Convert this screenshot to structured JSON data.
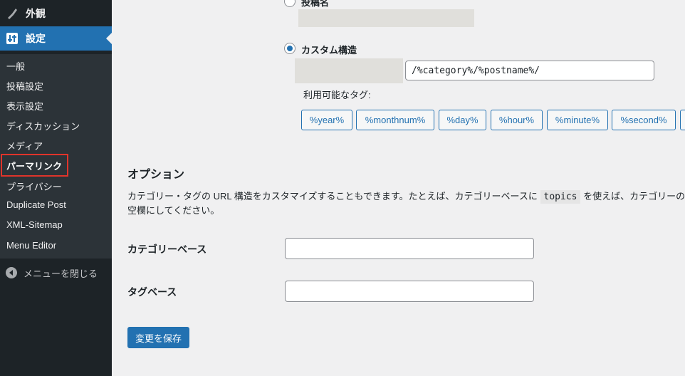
{
  "sidebar": {
    "appearance_label": "外観",
    "settings_label": "設定",
    "submenu": [
      "一般",
      "投稿設定",
      "表示設定",
      "ディスカッション",
      "メディア",
      "パーマリンク",
      "プライバシー",
      "Duplicate Post",
      "XML-Sitemap",
      "Menu Editor"
    ],
    "collapse_label": "メニューを閉じる"
  },
  "permalink": {
    "post_name_label": "投稿名",
    "custom_label": "カスタム構造",
    "custom_value": "/%category%/%postname%/",
    "available_tags_label": "利用可能なタグ:",
    "tags": [
      "%year%",
      "%monthnum%",
      "%day%",
      "%hour%",
      "%minute%",
      "%second%"
    ]
  },
  "options": {
    "title": "オプション",
    "desc_part1": "カテゴリー・タグの URL 構造をカスタマイズすることもできます。たとえば、カテゴリーベースに ",
    "desc_code": "topics",
    "desc_part2": " を使えば、カテゴリーの",
    "desc_line2": "空欄にしてください。",
    "category_base_label": "カテゴリーベース",
    "tag_base_label": "タグベース",
    "category_base_value": "",
    "tag_base_value": ""
  },
  "save_button": "変更を保存",
  "colors": {
    "accent": "#2271b1",
    "sidebar_bg": "#1d2327",
    "highlight_box": "#e0342b"
  }
}
